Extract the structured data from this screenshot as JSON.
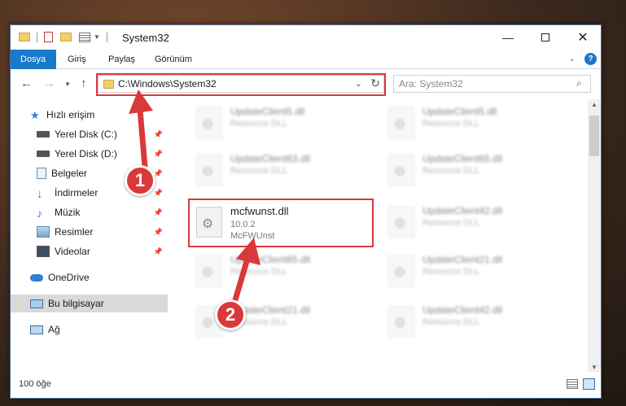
{
  "window": {
    "title": "System32"
  },
  "ribbon": {
    "tabs": [
      "Dosya",
      "Giriş",
      "Paylaş",
      "Görünüm"
    ]
  },
  "address": {
    "path": "C:\\Windows\\System32",
    "search_placeholder": "Ara: System32"
  },
  "sidebar": {
    "items": [
      {
        "label": "Hızlı erişim"
      },
      {
        "label": "Yerel Disk (C:)"
      },
      {
        "label": "Yerel Disk (D:)"
      },
      {
        "label": "Belgeler"
      },
      {
        "label": "İndirmeler"
      },
      {
        "label": "Müzik"
      },
      {
        "label": "Resimler"
      },
      {
        "label": "Videolar"
      },
      {
        "label": "OneDrive"
      },
      {
        "label": "Bu bilgisayar"
      },
      {
        "label": "Ağ"
      }
    ]
  },
  "files": [
    {
      "name": "UpdateClient5.dll",
      "line1": "Resource DLL"
    },
    {
      "name": "UpdateClient5.dll",
      "line1": "Resource DLL"
    },
    {
      "name": "UpdateClient63.dll",
      "line1": "Resource DLL"
    },
    {
      "name": "UpdateClient65.dll",
      "line1": "Resource DLL"
    },
    {
      "name": "mcfwunst.dll",
      "line1": "10.0.2",
      "line2": "McFWUnst"
    },
    {
      "name": "UpdateClient42.dll",
      "line1": "Resource DLL"
    },
    {
      "name": "UpdateClient65.dll",
      "line1": "Resource DLL"
    },
    {
      "name": "UpdateClient21.dll",
      "line1": "Resource DLL"
    },
    {
      "name": "UpdateClient21.dll",
      "line1": "Resource DLL"
    },
    {
      "name": "UpdateClient42.dll",
      "line1": "Resource DLL"
    }
  ],
  "status": {
    "count": "100 öğe"
  },
  "annotations": {
    "step1": "1",
    "step2": "2"
  },
  "colors": {
    "accent": "#1979ca",
    "highlight": "#d9393a"
  }
}
